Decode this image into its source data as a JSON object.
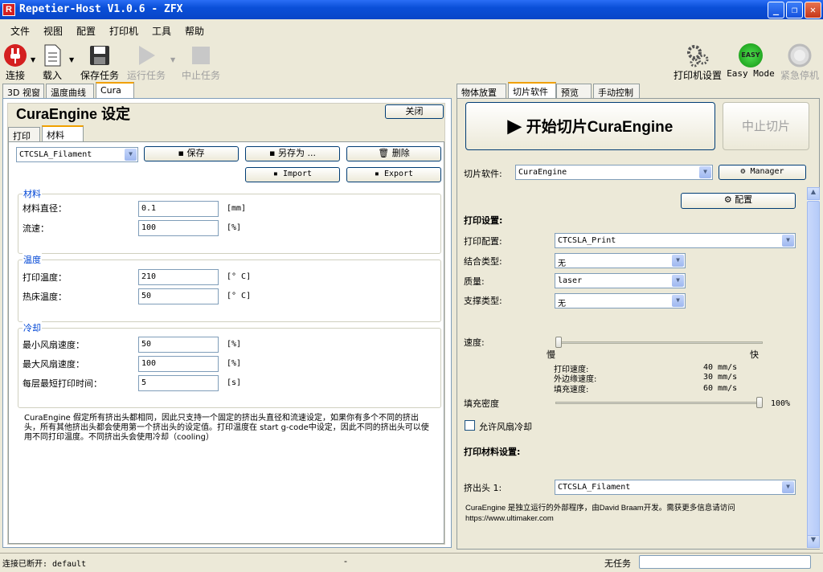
{
  "window": {
    "title": "Repetier-Host V1.0.6 - ZFX",
    "app_icon": "R"
  },
  "menu": [
    "文件",
    "视图",
    "配置",
    "打印机",
    "工具",
    "帮助"
  ],
  "toolbar": {
    "connect": "连接",
    "load": "载入",
    "save_job": "保存任务",
    "run_job": "运行任务",
    "stop_job": "中止任务",
    "printer_settings": "打印机设置",
    "easy_mode": "Easy Mode",
    "easy_badge": "EASY",
    "emergency": "紧急停机"
  },
  "left_tabs": [
    "3D 视窗",
    "温度曲线",
    "Cura"
  ],
  "cura": {
    "title": "CuraEngine 设定",
    "close": "关闭",
    "sub_tabs": [
      "打印",
      "材料"
    ],
    "profile": "CTCSLA_Filament",
    "save": "保存",
    "save_as": "另存为 ...",
    "delete": "删除",
    "import": "Import",
    "export": "Export",
    "material": {
      "title": "材料",
      "diameter_label": "材料直径：",
      "diameter": "0.1",
      "diameter_unit": "[mm]",
      "flow_label": "流速：",
      "flow": "100",
      "flow_unit": "[%]"
    },
    "temperature": {
      "title": "温度",
      "print_label": "打印温度：",
      "print": "210",
      "print_unit": "[° C]",
      "bed_label": "热床温度：",
      "bed": "50",
      "bed_unit": "[° C]"
    },
    "cooling": {
      "title": "冷却",
      "min_fan_label": "最小风扇速度：",
      "min_fan": "50",
      "min_fan_unit": "[%]",
      "max_fan_label": "最大风扇速度：",
      "max_fan": "100",
      "max_fan_unit": "[%]",
      "min_layer_label": "每层最短打印时间：",
      "min_layer": "5",
      "min_layer_unit": "[s]"
    },
    "note": "CuraEngine 假定所有挤出头都相同，因此只支持一个固定的挤出头直径和流速设定，如果你有多个不同的挤出头，所有其他挤出头都会使用第一个挤出头的设定值。打印温度在 start g-code中设定，因此不同的挤出头可以使用不同打印温度。不同挤出头会使用冷却（cooling）"
  },
  "right_tabs": [
    "物体放置",
    "切片软件",
    "预览",
    "手动控制"
  ],
  "slicer": {
    "start": "开始切片CuraEngine",
    "stop": "中止切片",
    "slicer_label": "切片软件:",
    "slicer_value": "CuraEngine",
    "manager": "Manager",
    "config": "配置",
    "print_settings": "打印设置:",
    "print_profile_label": "打印配置:",
    "print_profile": "CTCSLA_Print",
    "adhesion_label": "结合类型:",
    "adhesion": "无",
    "quality_label": "质量:",
    "quality": "laser",
    "support_label": "支撑类型:",
    "support": "无",
    "speed_label": "速度:",
    "slow": "慢",
    "fast": "快",
    "speed_slider": 0,
    "print_speed_label": "打印速度:",
    "print_speed": "40 mm/s",
    "outer_speed_label": "外边缘速度:",
    "outer_speed": "30 mm/s",
    "infill_speed_label": "填充速度:",
    "infill_speed": "60 mm/s",
    "infill_label": "填充密度",
    "infill_value": "100%",
    "infill_slider": 1.0,
    "fan_label": "允许风扇冷却",
    "material_settings": "打印材料设置:",
    "extruder_label": "挤出头 1:",
    "extruder": "CTCSLA_Filament",
    "footer": "CuraEngine 是独立运行的外部程序，由David Braam开发。需获更多信息请访问 https://www.ultimaker.com"
  },
  "status": {
    "connection": "连接已断开: default",
    "dash": "-",
    "job": "无任务"
  },
  "colors": {
    "title_blue": "#0a4fd8",
    "group_title": "#0046d5",
    "accent_tab": "#f0a000"
  }
}
